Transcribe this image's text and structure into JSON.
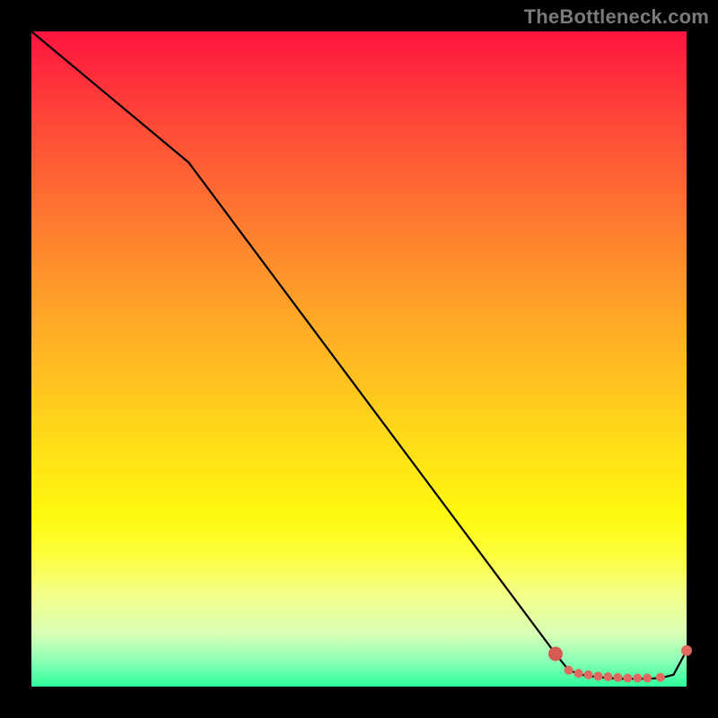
{
  "watermark": "TheBottleneck.com",
  "colors": {
    "line": "#000000",
    "marker_fill": "#e06a60",
    "marker_fill_big": "#d85b52",
    "plot_border": "#000000"
  },
  "chart_data": {
    "type": "line",
    "title": "",
    "xlabel": "",
    "ylabel": "",
    "xlim": [
      0,
      100
    ],
    "ylim": [
      0,
      100
    ],
    "series": [
      {
        "name": "curve",
        "x": [
          0,
          24,
          80,
          82,
          84,
          86,
          88,
          90,
          92,
          94,
          96,
          98,
          100
        ],
        "y": [
          100,
          80,
          5,
          2.5,
          1.8,
          1.5,
          1.3,
          1.2,
          1.2,
          1.2,
          1.3,
          1.8,
          5.5
        ]
      }
    ],
    "markers": {
      "name": "dots",
      "x": [
        80,
        82,
        83.5,
        85,
        86.5,
        88,
        89.5,
        91,
        92.5,
        94,
        96,
        100
      ],
      "y": [
        5,
        2.5,
        2.0,
        1.8,
        1.6,
        1.5,
        1.4,
        1.3,
        1.3,
        1.3,
        1.4,
        5.5
      ],
      "r": [
        8,
        5,
        5,
        5,
        5,
        5,
        5,
        5,
        5,
        5,
        5,
        6
      ]
    }
  }
}
